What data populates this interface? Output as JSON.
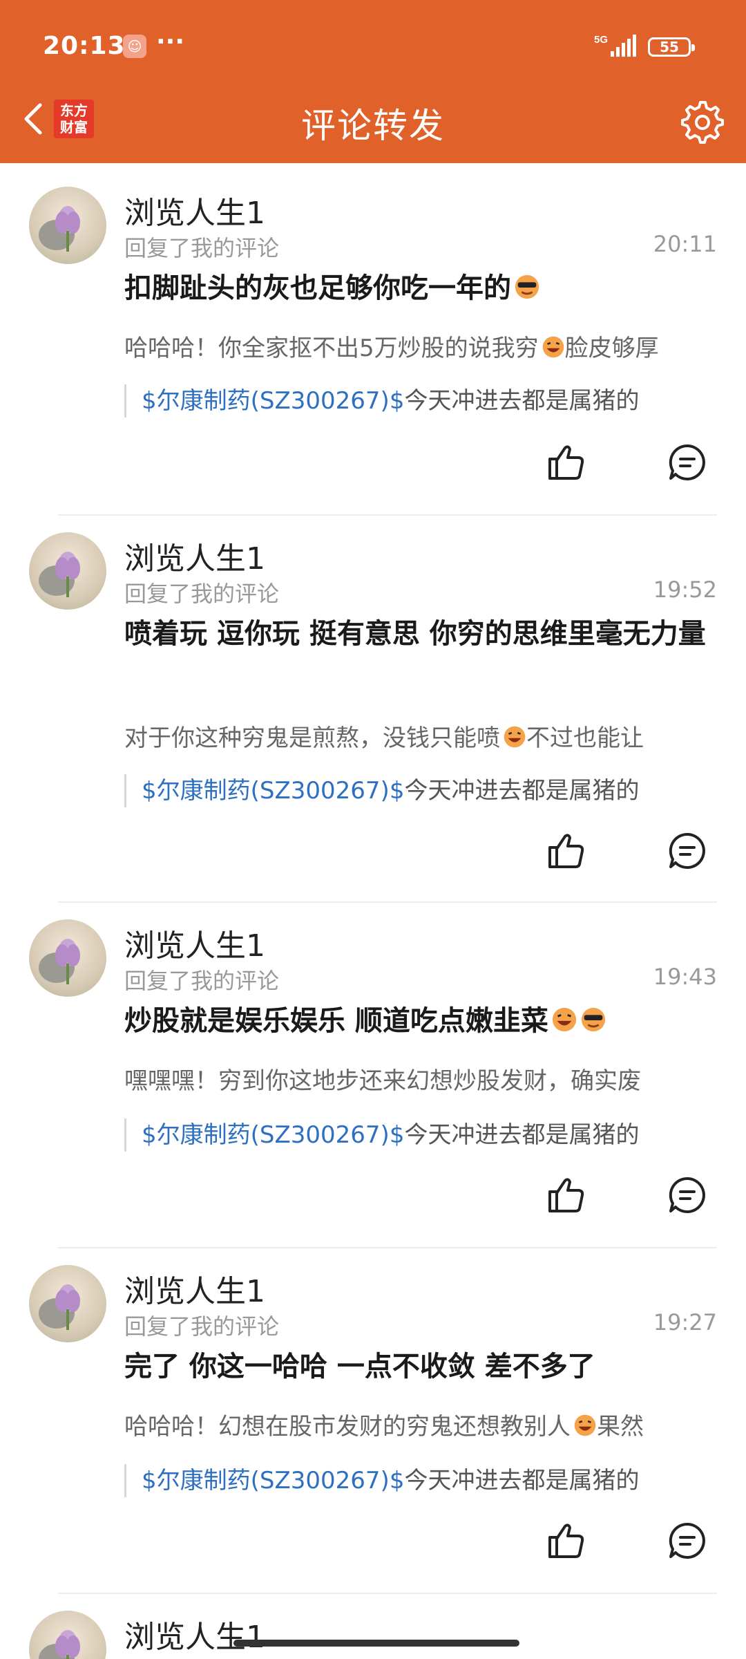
{
  "status_bar": {
    "time": "20:13",
    "more": "···",
    "battery": "55",
    "network": "5G"
  },
  "nav": {
    "title": "评论转发",
    "logo_line1": "东方",
    "logo_line2": "财富"
  },
  "theme": {
    "header_bg": "#e0612a",
    "link_color": "#2d6fc1"
  },
  "items": [
    {
      "username": "浏览人生1",
      "subtitle": "回复了我的评论",
      "time": "20:11",
      "reply": "扣脚趾头的灰也足够你吃一年的",
      "reply_emoji": [
        "cool-emoji"
      ],
      "original_a": "哈哈哈！你全家抠不出5万炒股的说我穷",
      "original_b": "脸皮够厚",
      "stock_link": "$尔康制药(SZ300267)$",
      "quote_tail": "今天冲进去都是属猪的"
    },
    {
      "username": "浏览人生1",
      "subtitle": "回复了我的评论",
      "time": "19:52",
      "reply": "喷着玩 逗你玩 挺有意思 你穷的思维里毫无力量",
      "reply_emoji": [],
      "original_a": "对于你这种穷鬼是煎熬，没钱只能喷",
      "original_b": "不过也能让",
      "stock_link": "$尔康制药(SZ300267)$",
      "quote_tail": "今天冲进去都是属猪的"
    },
    {
      "username": "浏览人生1",
      "subtitle": "回复了我的评论",
      "time": "19:43",
      "reply": "炒股就是娱乐娱乐 顺道吃点嫩韭菜",
      "reply_emoji": [
        "laugh-emoji",
        "cool-emoji"
      ],
      "original_a": "嘿嘿嘿！穷到你这地步还来幻想炒股发财，确实废",
      "original_b": "",
      "stock_link": "$尔康制药(SZ300267)$",
      "quote_tail": "今天冲进去都是属猪的"
    },
    {
      "username": "浏览人生1",
      "subtitle": "回复了我的评论",
      "time": "19:27",
      "reply": "完了 你这一哈哈  一点不收敛 差不多了",
      "reply_emoji": [],
      "original_a": "哈哈哈！幻想在股市发财的穷鬼还想教别人",
      "original_b": "果然",
      "stock_link": "$尔康制药(SZ300267)$",
      "quote_tail": "今天冲进去都是属猪的"
    },
    {
      "username": "浏览人生1"
    }
  ]
}
